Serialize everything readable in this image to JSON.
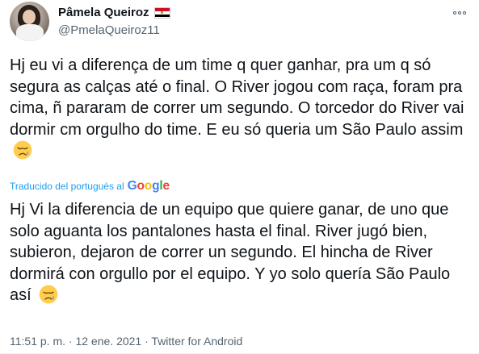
{
  "author": {
    "name": "Pâmela Queiroz",
    "handle": "@PmelaQueiroz11",
    "flag_icon": "egypt-flag-icon"
  },
  "tweet": {
    "text": "Hj eu vi a diferença de um time q quer ganhar, pra um q só segura as calças até o final. O River jogou com raça, foram pra cima, ñ pararam de correr um segundo. O torcedor do River vai dormir cm orgulho do time. E eu só queria um São Paulo assim",
    "emoji_icon": "sad-but-relieved-face-icon"
  },
  "translation": {
    "label": "Traducido del portugués al",
    "provider": "Google",
    "provider_letters": [
      "G",
      "o",
      "o",
      "g",
      "l",
      "e"
    ],
    "provider_colors": [
      "#4285f4",
      "#ea4335",
      "#fbbc05",
      "#4285f4",
      "#34a853",
      "#ea4335"
    ],
    "text": "Hj Vi la diferencia de un equipo que quiere ganar, de uno que solo aguanta los pantalones hasta el final. River jugó bien, subieron, dejaron de correr un segundo. El hincha de River dormirá con orgullo por el equipo. Y yo solo quería São Paulo así"
  },
  "meta": {
    "time": "11:51 p. m.",
    "separator": "·",
    "date": "12 ene. 2021",
    "source": "Twitter for Android"
  },
  "colors": {
    "link": "#1d9bf0",
    "secondary_text": "#536471",
    "primary_text": "#0f1419"
  }
}
